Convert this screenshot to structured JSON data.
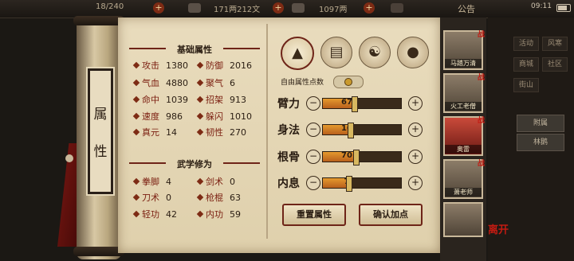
{
  "topbar": {
    "stamina": "18/240",
    "silver": "171两212文",
    "gold": "1097两",
    "notice": "公告",
    "clock": "09:11"
  },
  "side_tag": {
    "line1": "属",
    "line2": "性"
  },
  "basic_attrs": {
    "title": "基础属性",
    "rows": [
      {
        "a_label": "攻击",
        "a_value": "1380",
        "b_label": "防御",
        "b_value": "2016"
      },
      {
        "a_label": "气血",
        "a_value": "4880",
        "b_label": "聚气",
        "b_value": "6"
      },
      {
        "a_label": "命中",
        "a_value": "1039",
        "b_label": "招架",
        "b_value": "913"
      },
      {
        "a_label": "速度",
        "a_value": "986",
        "b_label": "躲闪",
        "b_value": "1010"
      },
      {
        "a_label": "真元",
        "a_value": "14",
        "b_label": "韧性",
        "b_value": "270"
      }
    ]
  },
  "martial_attrs": {
    "title": "武学修为",
    "rows": [
      {
        "a_label": "拳脚",
        "a_value": "4",
        "b_label": "剑术",
        "b_value": "0"
      },
      {
        "a_label": "刀术",
        "a_value": "0",
        "b_label": "枪棍",
        "b_value": "63"
      },
      {
        "a_label": "轻功",
        "a_value": "42",
        "b_label": "内功",
        "b_value": "59"
      }
    ]
  },
  "tab_icons": [
    "hat-icon",
    "book-icon",
    "taiji-icon",
    "body-icon"
  ],
  "free_points_label": "自由属性点数",
  "stats": [
    {
      "name": "臂力",
      "value": "67",
      "level": 0.4
    },
    {
      "name": "身法",
      "value": "10",
      "level": 0.35
    },
    {
      "name": "根骨",
      "value": "70",
      "level": 0.42
    },
    {
      "name": "内息",
      "value": "7",
      "level": 0.33
    }
  ],
  "buttons": {
    "reset": "重置属性",
    "confirm": "确认加点"
  },
  "heroes": [
    {
      "name": "马踏万清",
      "mark": "战"
    },
    {
      "name": "火工老僧",
      "mark": "战"
    },
    {
      "name": "奥雷",
      "mark": "战"
    },
    {
      "name": "萧老师",
      "mark": "战"
    },
    {
      "name": "",
      "mark": ""
    }
  ],
  "right_menu": {
    "items": [
      "活动",
      "风寒",
      "商城",
      "社区",
      "街山"
    ],
    "tabs": [
      "附属",
      "林鹅"
    ],
    "seal": "离开"
  },
  "colors": {
    "accent": "#6e2418",
    "paper": "#e9dcbd",
    "bar": "#e59a2e"
  }
}
